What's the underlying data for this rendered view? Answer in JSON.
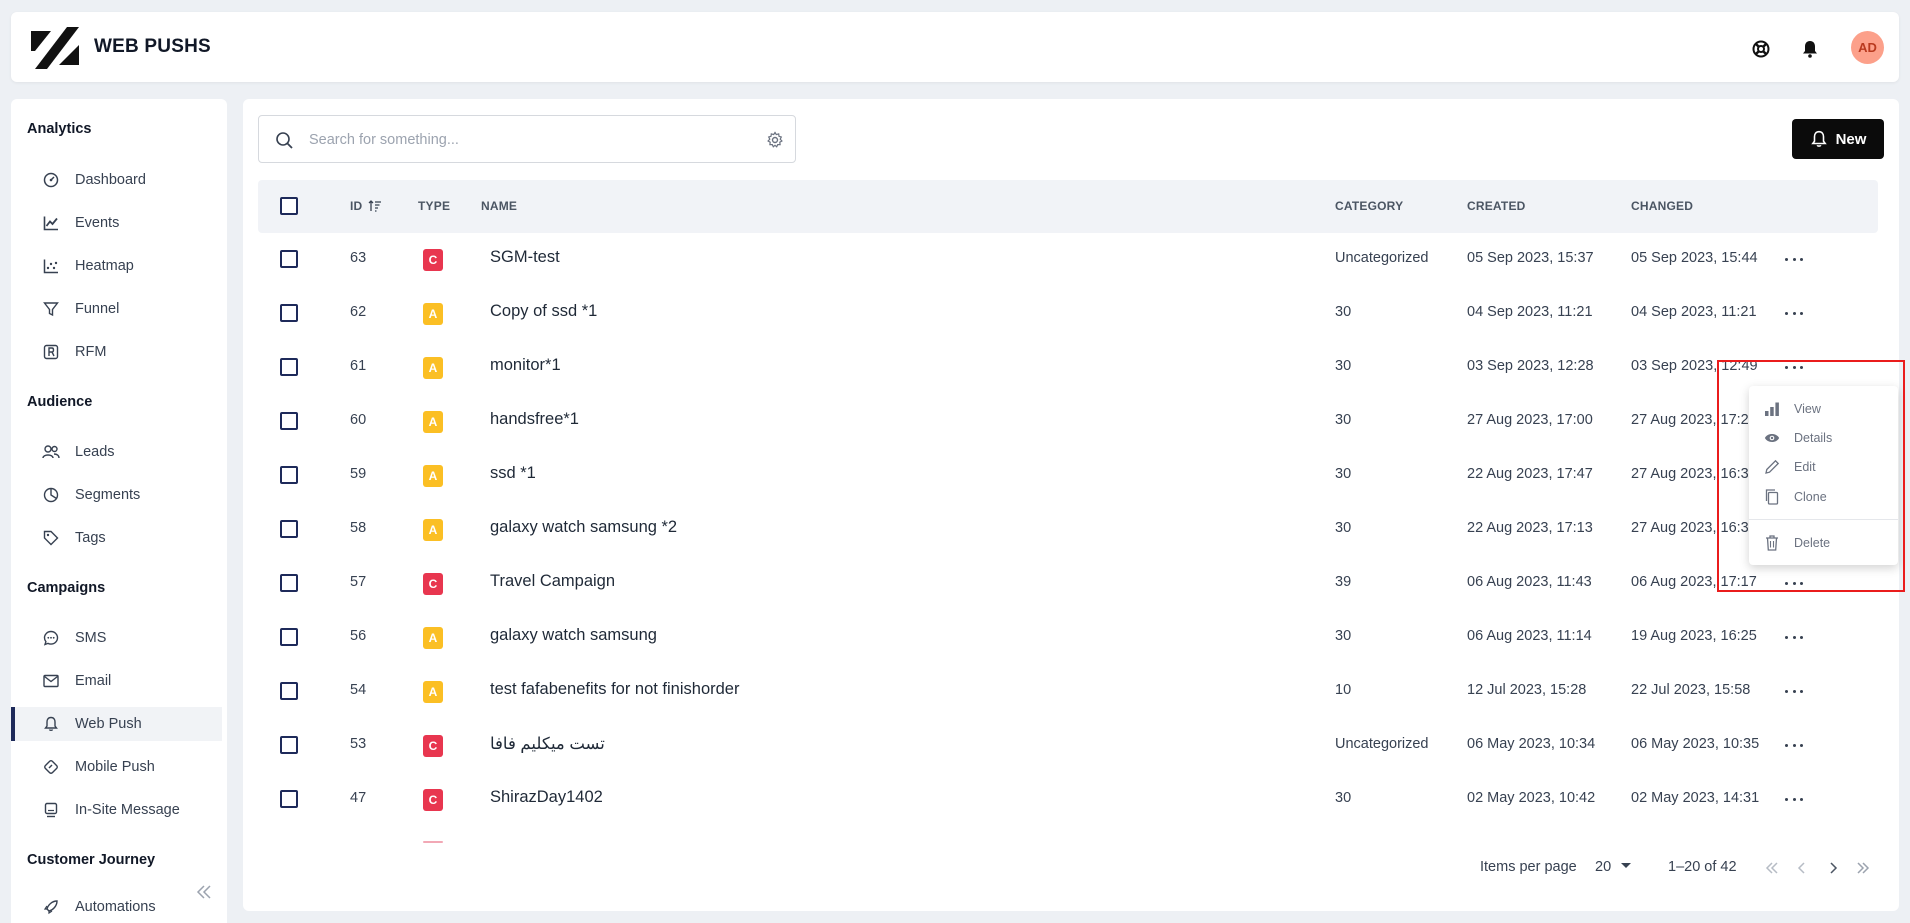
{
  "header": {
    "title": "WEB PUSHS",
    "avatar_initials": "AD"
  },
  "sidebar": {
    "sections": [
      {
        "title": "Analytics",
        "items": [
          {
            "label": "Dashboard",
            "icon": "gauge-icon"
          },
          {
            "label": "Events",
            "icon": "line-chart-icon"
          },
          {
            "label": "Heatmap",
            "icon": "scatter-icon"
          },
          {
            "label": "Funnel",
            "icon": "funnel-icon"
          },
          {
            "label": "RFM",
            "icon": "rfm-icon"
          }
        ]
      },
      {
        "title": "Audience",
        "items": [
          {
            "label": "Leads",
            "icon": "users-icon"
          },
          {
            "label": "Segments",
            "icon": "pie-icon"
          },
          {
            "label": "Tags",
            "icon": "tag-icon"
          }
        ]
      },
      {
        "title": "Campaigns",
        "items": [
          {
            "label": "SMS",
            "icon": "chat-icon"
          },
          {
            "label": "Email",
            "icon": "mail-icon"
          },
          {
            "label": "Web Push",
            "icon": "bell-icon",
            "active": true
          },
          {
            "label": "Mobile Push",
            "icon": "mobile-push-icon"
          },
          {
            "label": "In-Site Message",
            "icon": "monitor-icon"
          }
        ]
      },
      {
        "title": "Customer Journey",
        "items": [
          {
            "label": "Automations",
            "icon": "rocket-icon"
          }
        ]
      }
    ]
  },
  "search": {
    "placeholder": "Search for something..."
  },
  "toolbar": {
    "new_label": "New"
  },
  "table": {
    "columns": {
      "id": "ID",
      "type": "TYPE",
      "name": "NAME",
      "category": "CATEGORY",
      "created": "CREATED",
      "changed": "CHANGED"
    },
    "rows": [
      {
        "id": "63",
        "type": "C",
        "name": "SGM-test",
        "category": "Uncategorized",
        "created": "05 Sep 2023, 15:37",
        "changed": "05 Sep 2023, 15:44"
      },
      {
        "id": "62",
        "type": "A",
        "name": "Copy of ssd *1",
        "category": "30",
        "created": "04 Sep 2023, 11:21",
        "changed": "04 Sep 2023, 11:21"
      },
      {
        "id": "61",
        "type": "A",
        "name": "monitor*1",
        "category": "30",
        "created": "03 Sep 2023, 12:28",
        "changed": "03 Sep 2023, 12:49"
      },
      {
        "id": "60",
        "type": "A",
        "name": "handsfree*1",
        "category": "30",
        "created": "27 Aug 2023, 17:00",
        "changed": "27 Aug 2023, 17:2"
      },
      {
        "id": "59",
        "type": "A",
        "name": "ssd *1",
        "category": "30",
        "created": "22 Aug 2023, 17:47",
        "changed": "27 Aug 2023, 16:3"
      },
      {
        "id": "58",
        "type": "A",
        "name": "galaxy watch samsung *2",
        "category": "30",
        "created": "22 Aug 2023, 17:13",
        "changed": "27 Aug 2023, 16:3"
      },
      {
        "id": "57",
        "type": "C",
        "name": "Travel Campaign",
        "category": "39",
        "created": "06 Aug 2023, 11:43",
        "changed": "06 Aug 2023, 17:17"
      },
      {
        "id": "56",
        "type": "A",
        "name": "galaxy watch samsung",
        "category": "30",
        "created": "06 Aug 2023, 11:14",
        "changed": "19 Aug 2023, 16:25"
      },
      {
        "id": "54",
        "type": "A",
        "name": "test fafabenefits for not finishorder",
        "category": "10",
        "created": "12 Jul 2023, 15:28",
        "changed": "22 Jul 2023, 15:58"
      },
      {
        "id": "53",
        "type": "C",
        "name": "تست میکلیم فافا",
        "category": "Uncategorized",
        "created": "06 May 2023, 10:34",
        "changed": "06 May 2023, 10:35"
      },
      {
        "id": "47",
        "type": "C",
        "name": "ShirazDay1402",
        "category": "30",
        "created": "02 May 2023, 10:42",
        "changed": "02 May 2023, 14:31"
      }
    ]
  },
  "badge_colors": {
    "C": "#e8364f",
    "A": "#fbbf24"
  },
  "pagination": {
    "items_per_page_label": "Items per page",
    "page_size": "20",
    "range": "1–20 of 42"
  },
  "context_menu": {
    "items": [
      {
        "label": "View",
        "icon": "bar-chart-icon"
      },
      {
        "label": "Details",
        "icon": "eye-icon"
      },
      {
        "label": "Edit",
        "icon": "pencil-icon"
      },
      {
        "label": "Clone",
        "icon": "copy-icon"
      },
      {
        "label": "Delete",
        "icon": "trash-icon"
      }
    ]
  }
}
